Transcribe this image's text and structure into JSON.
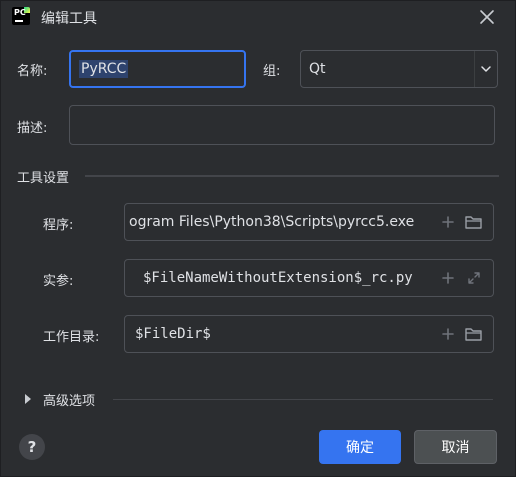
{
  "window": {
    "title": "编辑工具",
    "app_logo_text": "PC"
  },
  "form": {
    "name_label": "名称:",
    "name_value": "PyRCC",
    "group_label": "组:",
    "group_value": "Qt",
    "description_label": "描述:",
    "description_value": ""
  },
  "tool_settings": {
    "title": "工具设置",
    "program_label": "程序:",
    "program_value": "ogram Files\\Python38\\Scripts\\pyrcc5.exe",
    "args_label": "实参:",
    "args_value": "$FileNameWithoutExtension$_rc.py",
    "workdir_label": "工作目录:",
    "workdir_value": "$FileDir$"
  },
  "advanced": {
    "label": "高级选项"
  },
  "footer": {
    "help_label": "?",
    "ok_label": "确定",
    "cancel_label": "取消"
  },
  "colors": {
    "background": "#2b2d30",
    "accent": "#3574f0",
    "field_border": "#4e5157",
    "selection": "#2e436e"
  },
  "icons": [
    "pycharm-logo-icon",
    "close-icon",
    "chevron-down-icon",
    "add-macro-icon",
    "folder-icon",
    "expand-icon",
    "triangle-right-icon"
  ]
}
